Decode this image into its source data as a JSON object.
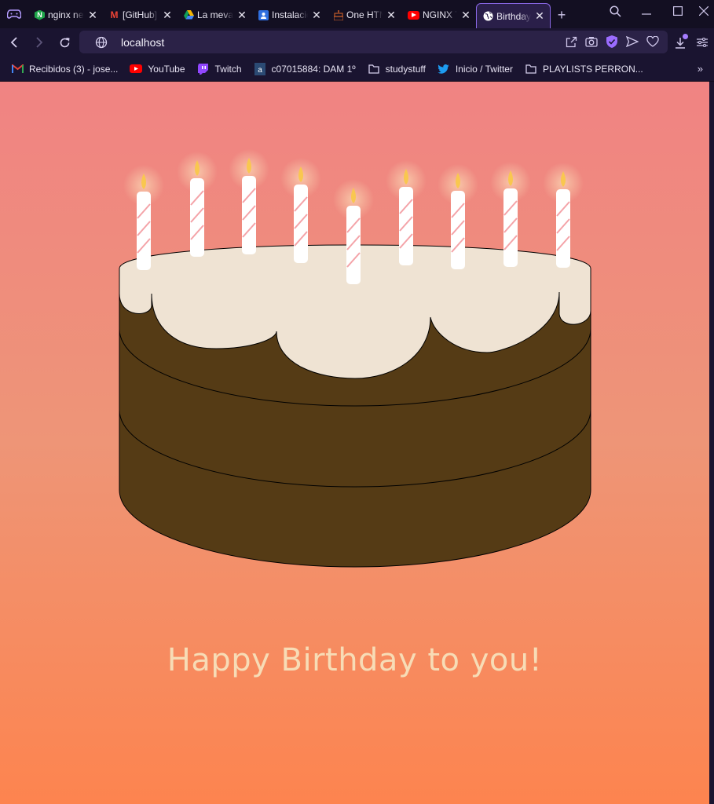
{
  "browser": {
    "tabs": [
      {
        "title": "nginx news",
        "icon": "nginx-icon",
        "color": "#1fa64a",
        "active": false
      },
      {
        "title": "[GitHub] A third-party",
        "icon": "gmail-icon",
        "color": "#ea4335",
        "active": false
      },
      {
        "title": "La meva unitat",
        "icon": "google-drive-icon",
        "color": "#f4b400",
        "active": false
      },
      {
        "title": "Instalación",
        "icon": "contacts-icon",
        "color": "#2f6fe0",
        "active": false
      },
      {
        "title": "One HTML Page",
        "icon": "cake-icon",
        "color": "#c05a2a",
        "active": false
      },
      {
        "title": "NGINX Tutorial",
        "icon": "youtube-icon",
        "color": "#ff0000",
        "active": false
      },
      {
        "title": "Birthday",
        "icon": "globe-icon",
        "color": "#ffffff",
        "active": true
      }
    ],
    "address": "localhost",
    "bookmarks": [
      {
        "label": "Recibidos (3) - jose...",
        "icon": "gmail-icon"
      },
      {
        "label": "YouTube",
        "icon": "youtube-icon"
      },
      {
        "label": "Twitch",
        "icon": "twitch-icon"
      },
      {
        "label": "c07015884: DAM 1º",
        "icon": "moodle-icon"
      },
      {
        "label": "studystuff",
        "icon": "folder-icon"
      },
      {
        "label": "Inicio / Twitter",
        "icon": "twitter-icon"
      },
      {
        "label": "PLAYLISTS PERRON...",
        "icon": "folder-icon"
      }
    ]
  },
  "page": {
    "greeting": "Happy Birthday to you!",
    "candle_count": 9,
    "colors": {
      "background_top": "#f08383",
      "background_bottom": "#fd844f",
      "cake": "#553b15",
      "frosting": "#efe3d3",
      "candle": "#ffffff",
      "candle_stripe": "#f4a3a8",
      "flame": "#f9c74f",
      "text": "#f7dcb6"
    }
  }
}
